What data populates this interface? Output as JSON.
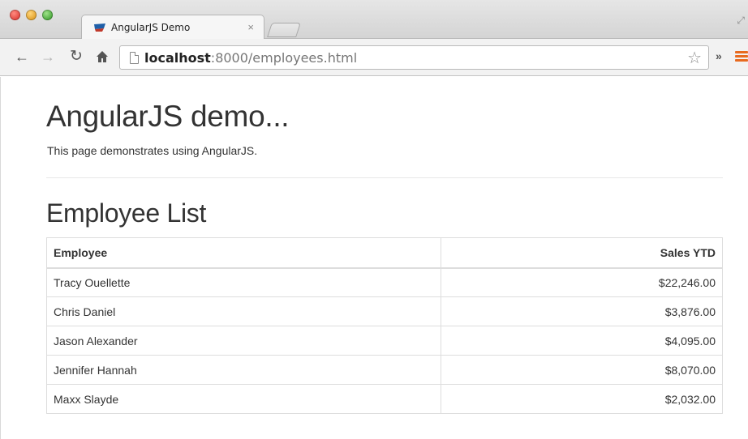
{
  "browser": {
    "tab_title": "AngularJS Demo",
    "tab_close": "×",
    "url_host": "localhost",
    "url_path": ":8000/employees.html",
    "icons": {
      "back": "arrow-left",
      "forward": "arrow-right",
      "reload": "reload",
      "home": "home",
      "star": "star-outline",
      "overflow": "double-chevron-right",
      "menu": "hamburger-menu"
    },
    "menu_color": "#e86a1f"
  },
  "page": {
    "title": "AngularJS demo...",
    "subtitle": "This page demonstrates using AngularJS.",
    "section_title": "Employee List"
  },
  "table": {
    "headers": [
      "Employee",
      "Sales YTD"
    ],
    "rows": [
      [
        "Tracy Ouellette",
        "$22,246.00"
      ],
      [
        "Chris Daniel",
        "$3,876.00"
      ],
      [
        "Jason Alexander",
        "$4,095.00"
      ],
      [
        "Jennifer Hannah",
        "$8,070.00"
      ],
      [
        "Maxx Slayde",
        "$2,032.00"
      ]
    ]
  }
}
